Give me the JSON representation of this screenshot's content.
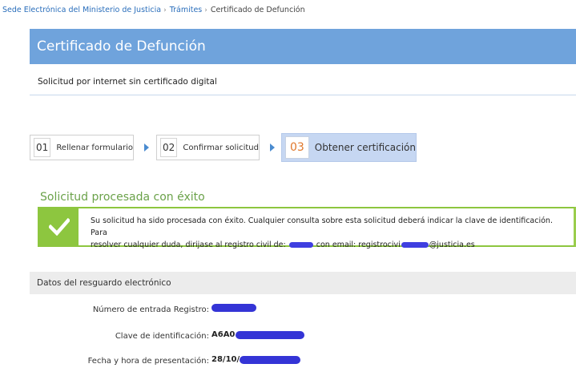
{
  "breadcrumb": {
    "items": [
      {
        "label": "Sede Electrónica del Ministerio de Justicia"
      },
      {
        "label": "Trámites"
      }
    ],
    "separator": "›",
    "current": "Certificado de Defunción"
  },
  "header": {
    "title": "Certificado de Defunción",
    "subtitle": "Solicitud por internet sin certificado digital"
  },
  "steps": [
    {
      "number": "01",
      "label": "Rellenar formulario"
    },
    {
      "number": "02",
      "label": "Confirmar solicitud"
    },
    {
      "number": "03",
      "label": "Obtener certificación"
    }
  ],
  "success": {
    "title": "Solicitud procesada con éxito",
    "line1": "Su solicitud ha sido procesada con éxito. Cualquier consulta sobre esta solicitud deberá indicar la clave de identificación. Para",
    "line2_a": "resolver cualquier duda, dirijase al registro civil de:",
    "line2_b": "con email: registrocivi",
    "line2_c": "@justicia.es"
  },
  "data_section": {
    "title": "Datos del resguardo electrónico",
    "rows": [
      {
        "label": "Número de entrada Registro:",
        "value": ""
      },
      {
        "label": "Clave de identificación:",
        "value": "A6A0"
      },
      {
        "label": "Fecha y hora de presentación:",
        "value": "28/10/"
      }
    ]
  },
  "colors": {
    "header_blue": "#6fa3dc",
    "success_green": "#8dc63f",
    "active_step": "#c6d7f2",
    "step_number_active": "#e0782c",
    "redaction": "#3434d6"
  }
}
